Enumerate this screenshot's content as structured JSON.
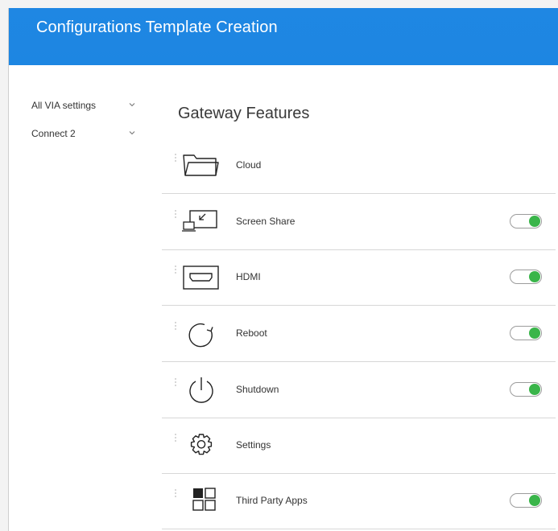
{
  "header": {
    "title": "Configurations Template Creation"
  },
  "sidebar": {
    "items": [
      {
        "label": "All VIA settings"
      },
      {
        "label": "Connect 2"
      }
    ]
  },
  "main": {
    "section_title": "Gateway Features",
    "features": [
      {
        "label": "Cloud",
        "icon": "folder-icon",
        "toggle": false
      },
      {
        "label": "Screen Share",
        "icon": "screen-share-icon",
        "toggle": true,
        "enabled": true
      },
      {
        "label": "HDMI",
        "icon": "hdmi-icon",
        "toggle": true,
        "enabled": true
      },
      {
        "label": "Reboot",
        "icon": "reboot-icon",
        "toggle": true,
        "enabled": true
      },
      {
        "label": "Shutdown",
        "icon": "power-icon",
        "toggle": true,
        "enabled": true
      },
      {
        "label": "Settings",
        "icon": "gear-icon",
        "toggle": false
      },
      {
        "label": "Third Party Apps",
        "icon": "apps-grid-icon",
        "toggle": true,
        "enabled": true
      }
    ]
  },
  "colors": {
    "header": "#1e86e2",
    "toggle_on": "#3ab54a",
    "divider": "#d7d7d7"
  }
}
